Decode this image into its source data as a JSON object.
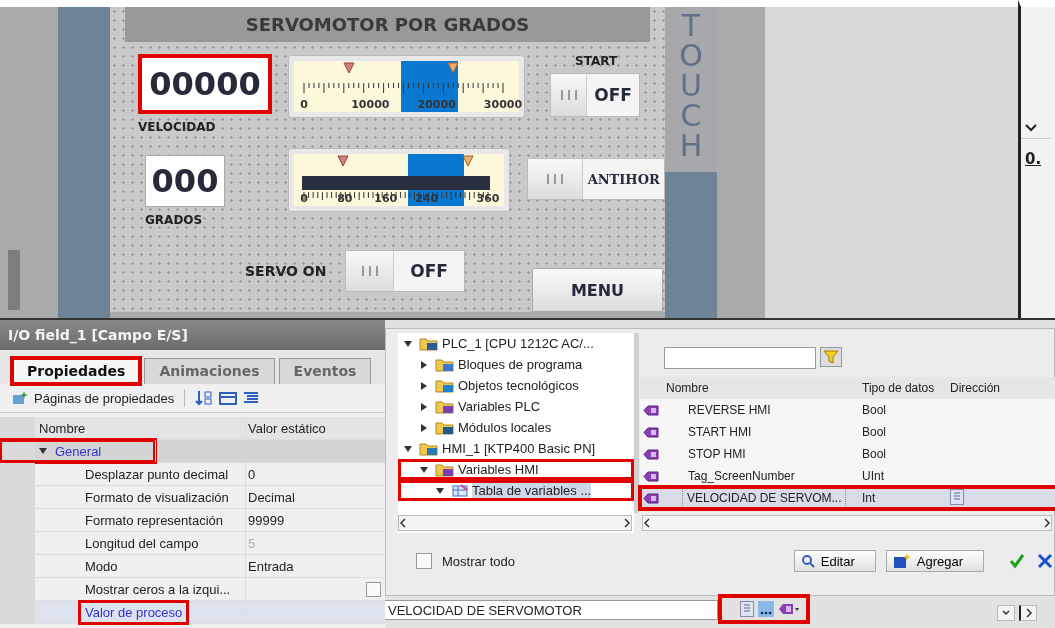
{
  "hmi": {
    "title": "SERVOMOTOR POR GRADOS",
    "bezel_text": "TOUCH",
    "fields": [
      {
        "value": "00000",
        "label": "VELOCIDAD",
        "highlighted": true
      },
      {
        "value": "000",
        "label": "GRADOS",
        "highlighted": false
      }
    ],
    "gauges": [
      {
        "ticks": [
          "0",
          "10000",
          "20000",
          "30000"
        ]
      },
      {
        "ticks": [
          "0",
          "80",
          "160",
          "240",
          "360"
        ]
      }
    ],
    "switches": [
      {
        "caption": "START",
        "text": "OFF",
        "on": false
      },
      {
        "text": "ANTIHOR",
        "on": false
      },
      {
        "caption": "SERVO ON",
        "text": "OFF",
        "on": false
      }
    ],
    "buttons": [
      {
        "label": "MENU"
      }
    ]
  },
  "side_panel": {
    "value": "0."
  },
  "properties": {
    "title": "I/O field_1 [Campo E/S]",
    "tabs": [
      {
        "label": "Propiedades",
        "selected": true,
        "highlighted": true
      },
      {
        "label": "Animaciones",
        "selected": false,
        "highlighted": false
      },
      {
        "label": "Eventos",
        "selected": false,
        "highlighted": false
      }
    ],
    "toolbar_label": "Páginas de propiedades",
    "columns": [
      "Nombre",
      "Valor estático"
    ],
    "rows": [
      {
        "kind": "group",
        "name": "General",
        "expanded": true,
        "highlighted": true
      },
      {
        "kind": "value",
        "name": "Desplazar punto decimal",
        "value": "0",
        "disabled": false
      },
      {
        "kind": "value",
        "name": "Formato de visualización",
        "value": "Decimal",
        "disabled": false
      },
      {
        "kind": "value",
        "name": "Formato representación",
        "value": "99999",
        "disabled": false
      },
      {
        "kind": "value",
        "name": "Longitud del campo",
        "value": "5",
        "disabled": true
      },
      {
        "kind": "value",
        "name": "Modo",
        "value": "Entrada",
        "disabled": false
      },
      {
        "kind": "checkbox",
        "name": "Mostrar ceros a la izqui...",
        "checked": false
      },
      {
        "kind": "link",
        "name": "Valor de proceso",
        "highlighted": true
      }
    ]
  },
  "dialog": {
    "tree": [
      {
        "label": "PLC_1 [CPU 1212C AC/...",
        "kind": "device",
        "expanded": true,
        "selected": false,
        "children": [
          {
            "label": "Bloques de programa",
            "kind": "blocks",
            "expanded": false,
            "selected": false
          },
          {
            "label": "Objetos tecnológicos",
            "kind": "objects",
            "expanded": false,
            "selected": false
          },
          {
            "label": "Variables PLC",
            "kind": "tags",
            "expanded": false,
            "selected": false
          },
          {
            "label": "Módulos locales",
            "kind": "modules",
            "expanded": false,
            "selected": false
          }
        ]
      },
      {
        "label": "HMI_1 [KTP400 Basic PN]",
        "kind": "hmi",
        "expanded": true,
        "selected": false,
        "children": [
          {
            "label": "Variables HMI",
            "kind": "tags",
            "expanded": true,
            "selected": false,
            "highlighted": true,
            "children": [
              {
                "label": "Tabla de variables ...",
                "kind": "table",
                "expanded": true,
                "selected": true,
                "highlighted": true
              }
            ]
          }
        ]
      }
    ],
    "show_all": {
      "label": "Mostrar todo",
      "checked": false
    },
    "columns": [
      "Nombre",
      "Tipo de datos",
      "Dirección"
    ],
    "rows": [
      {
        "name": "REVERSE HMI",
        "type": "Bool",
        "selected": false
      },
      {
        "name": "START HMI",
        "type": "Bool",
        "selected": false
      },
      {
        "name": "STOP HMI",
        "type": "Bool",
        "selected": false
      },
      {
        "name": "Tag_ScreenNumber",
        "type": "UInt",
        "selected": false
      },
      {
        "name": "VELOCIDAD DE SERVOM...",
        "type": "Int",
        "selected": true
      }
    ],
    "buttons": [
      {
        "kind": "edit",
        "label": "Editar"
      },
      {
        "kind": "add",
        "label": "Agregar"
      }
    ]
  },
  "process_value": {
    "value": "VELOCIDAD DE SERVOMOTOR",
    "tools_highlighted": true
  }
}
